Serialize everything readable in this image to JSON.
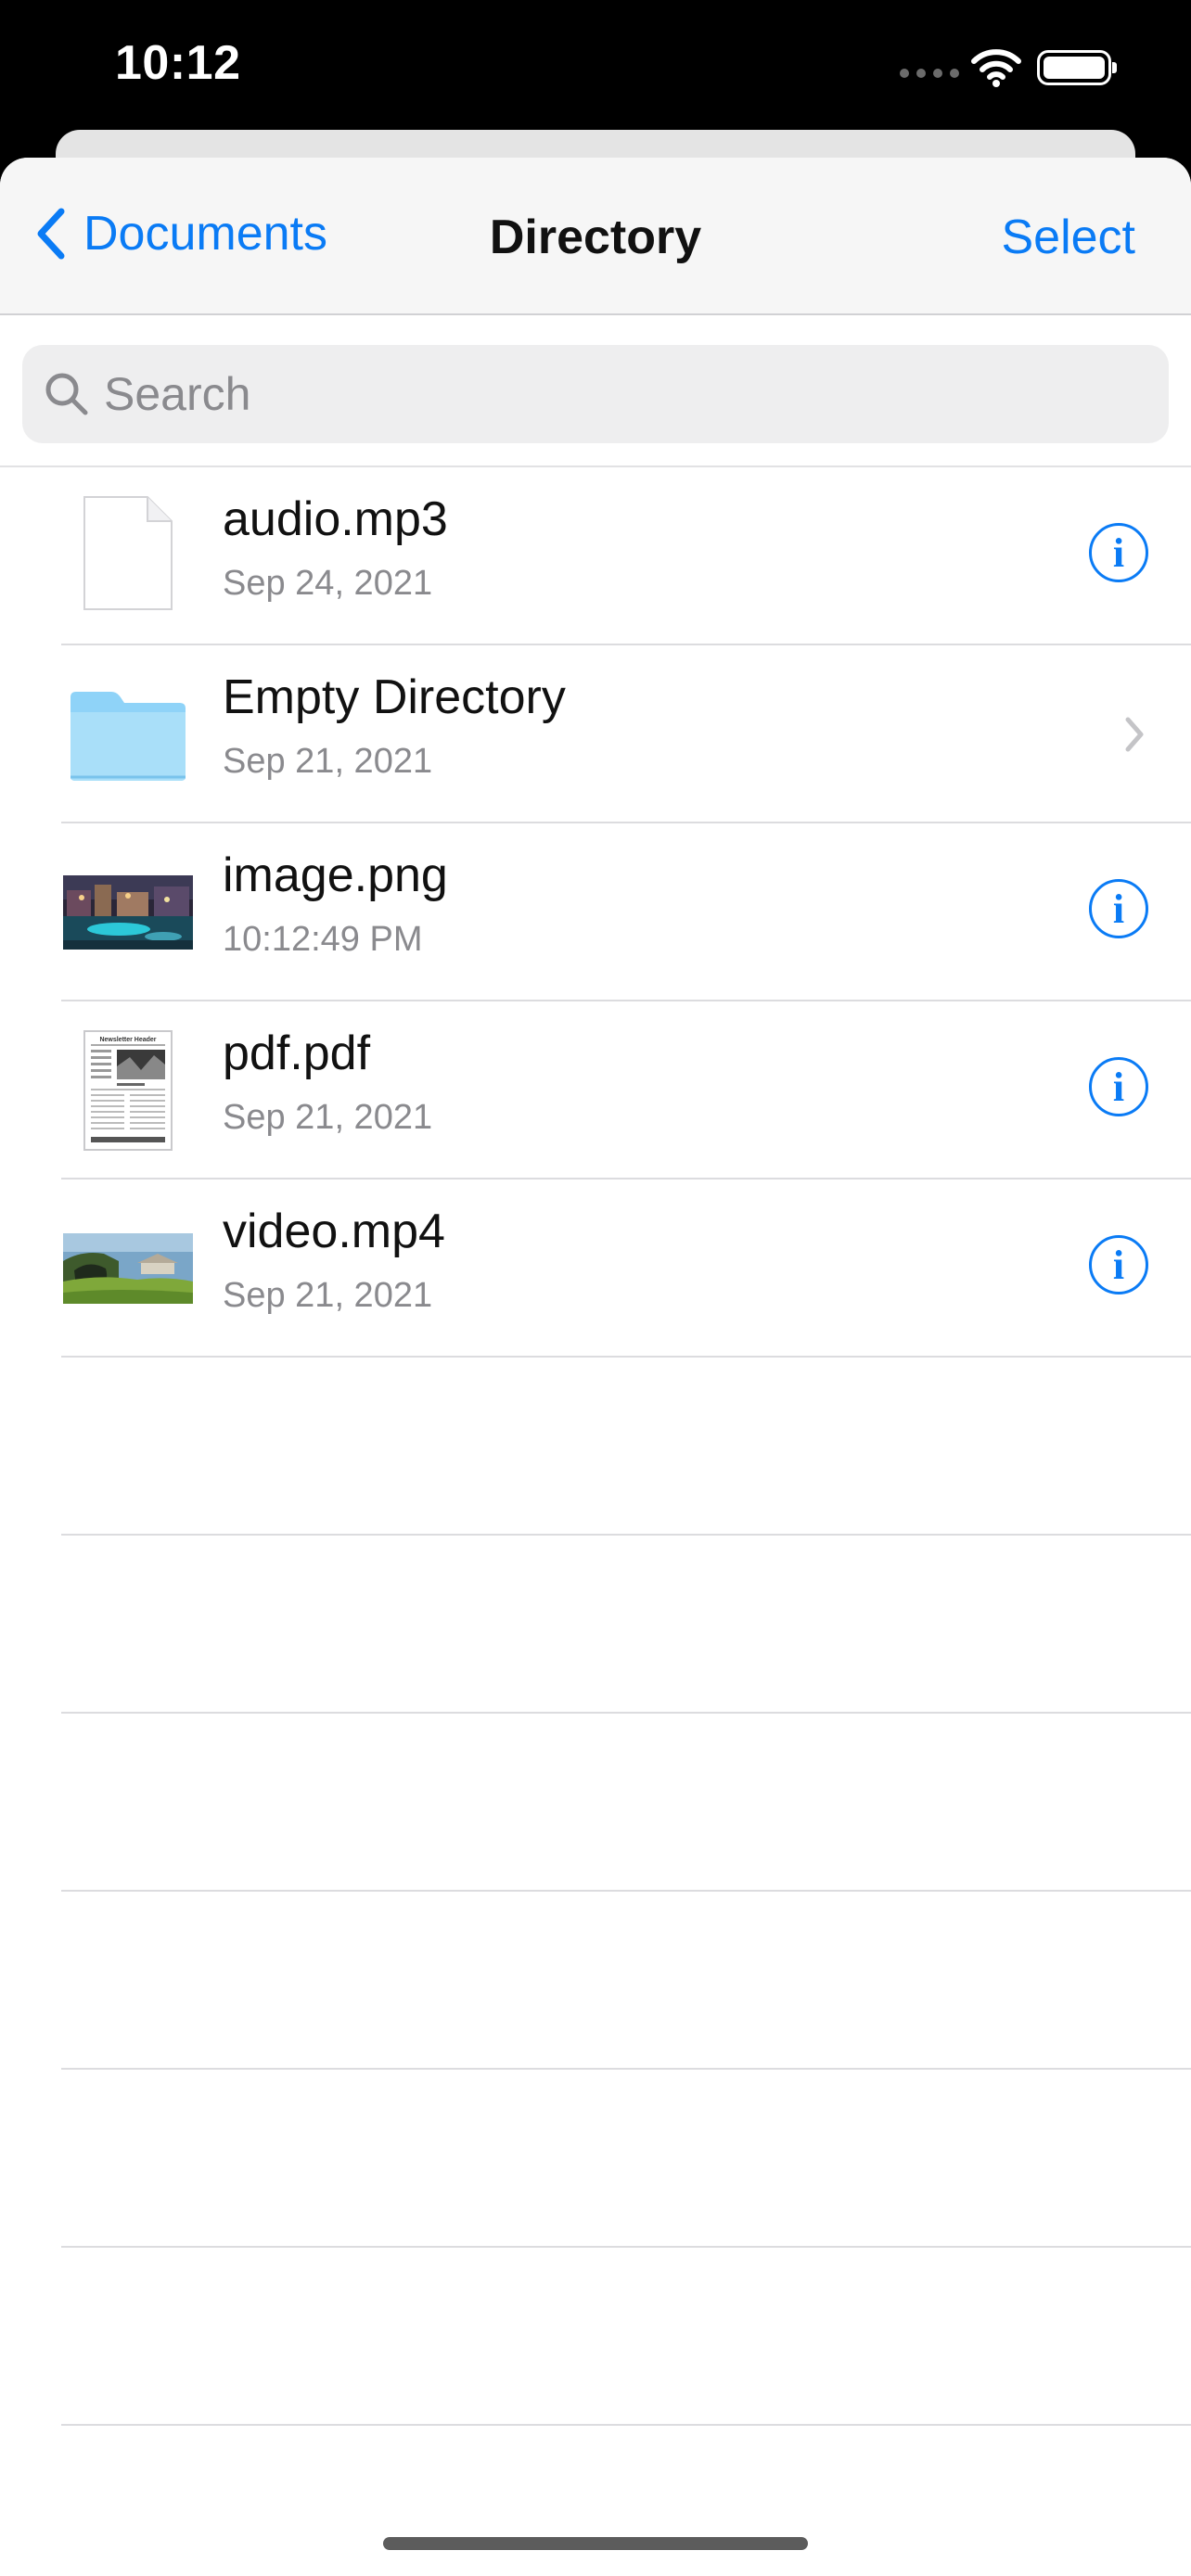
{
  "status_bar": {
    "time": "10:12",
    "icons": [
      "signal-dots-icon",
      "wifi-icon",
      "battery-icon"
    ]
  },
  "nav": {
    "back_label": "Documents",
    "title": "Directory",
    "select_label": "Select",
    "accent_color": "#0a7bf5"
  },
  "search": {
    "placeholder": "Search",
    "value": ""
  },
  "files": [
    {
      "name": "audio.mp3",
      "date": "Sep 24, 2021",
      "kind": "document",
      "accessory": "info-icon"
    },
    {
      "name": "Empty Directory",
      "date": "Sep 21, 2021",
      "kind": "folder",
      "accessory": "chevron-right-icon"
    },
    {
      "name": "image.png",
      "date": "10:12:49 PM",
      "kind": "image",
      "accessory": "info-icon"
    },
    {
      "name": "pdf.pdf",
      "date": "Sep 21, 2021",
      "kind": "pdf",
      "accessory": "info-icon"
    },
    {
      "name": "video.mp4",
      "date": "Sep 21, 2021",
      "kind": "video",
      "accessory": "info-icon"
    }
  ],
  "info_glyph": "i",
  "pdf_thumb_header": "Newsletter Header"
}
